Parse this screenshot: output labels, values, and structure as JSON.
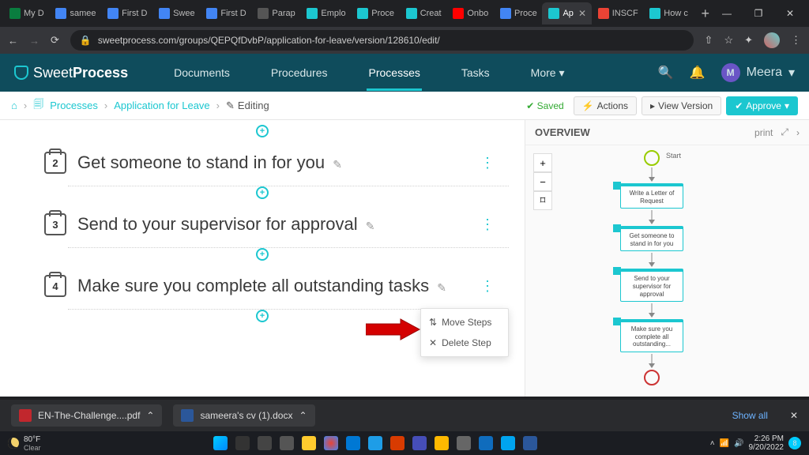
{
  "browser": {
    "tabs": [
      {
        "label": "My D",
        "fav": "#0a7d3f"
      },
      {
        "label": "samee",
        "fav": "#4285f4"
      },
      {
        "label": "First D",
        "fav": "#4285f4"
      },
      {
        "label": "Swee",
        "fav": "#4285f4"
      },
      {
        "label": "First D",
        "fav": "#4285f4"
      },
      {
        "label": "Parap",
        "fav": "#555"
      },
      {
        "label": "Emplo",
        "fav": "#1cc7d0"
      },
      {
        "label": "Proce",
        "fav": "#1cc7d0"
      },
      {
        "label": "Creat",
        "fav": "#1cc7d0"
      },
      {
        "label": "Onbo",
        "fav": "#f00"
      },
      {
        "label": "Proce",
        "fav": "#4285f4"
      },
      {
        "label": "Ap",
        "fav": "#1cc7d0",
        "active": true
      },
      {
        "label": "INSCF",
        "fav": "#ea4335"
      },
      {
        "label": "How c",
        "fav": "#1cc7d0"
      }
    ],
    "url": "sweetprocess.com/groups/QEPQfDvbP/application-for-leave/version/128610/edit/"
  },
  "app": {
    "brand_a": "Sweet",
    "brand_b": "Process",
    "nav": [
      "Documents",
      "Procedures",
      "Processes",
      "Tasks",
      "More ▾"
    ],
    "active_nav": "Processes",
    "user_initial": "M",
    "user_name": "Meera"
  },
  "toolbar": {
    "crumbs": {
      "processes": "Processes",
      "process": "Application for Leave",
      "editing": "Editing"
    },
    "saved": "✔ Saved",
    "actions": "Actions",
    "view_version": "View Version",
    "approve": "Approve"
  },
  "steps": [
    {
      "num": "2",
      "title": "Get someone to stand in for you"
    },
    {
      "num": "3",
      "title": "Send to your supervisor for approval"
    },
    {
      "num": "4",
      "title": "Make sure you complete all outstanding tasks"
    }
  ],
  "context_menu": {
    "move": "Move Steps",
    "delete": "Delete Step"
  },
  "overview": {
    "title": "OVERVIEW",
    "print": "print",
    "start": "Start",
    "nodes": [
      "Write a Letter of Request",
      "Get someone to stand in for you",
      "Send to your supervisor for approval",
      "Make sure you complete all outstanding..."
    ]
  },
  "downloads": {
    "item1": "EN-The-Challenge....pdf",
    "item2": "sameera's cv (1).docx",
    "showall": "Show all"
  },
  "system": {
    "temp": "80°F",
    "cond": "Clear",
    "time": "2:26 PM",
    "date": "9/20/2022"
  }
}
